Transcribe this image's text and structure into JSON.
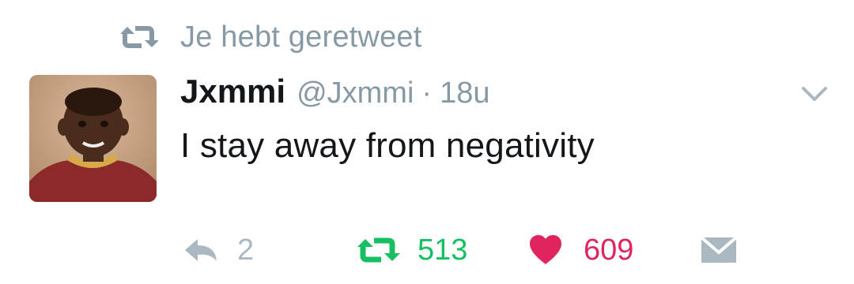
{
  "retweet_context": {
    "label": "Je hebt geretweet",
    "icon": "retweet-icon",
    "color": "#8899a6"
  },
  "tweet": {
    "avatar": "user-avatar-photo",
    "name": "Jxmmi",
    "handle": "@Jxmmi",
    "separator": "·",
    "time": "18u",
    "text": "I stay away from negativity"
  },
  "actions": {
    "reply": {
      "icon": "reply-icon",
      "count": "2",
      "color": "#aab8c2"
    },
    "retweet": {
      "icon": "retweet-icon",
      "count": "513",
      "color": "#17bf63"
    },
    "like": {
      "icon": "heart-icon",
      "count": "609",
      "color": "#e0245e"
    },
    "direct_message": {
      "icon": "envelope-icon",
      "color": "#aab8c2"
    }
  }
}
